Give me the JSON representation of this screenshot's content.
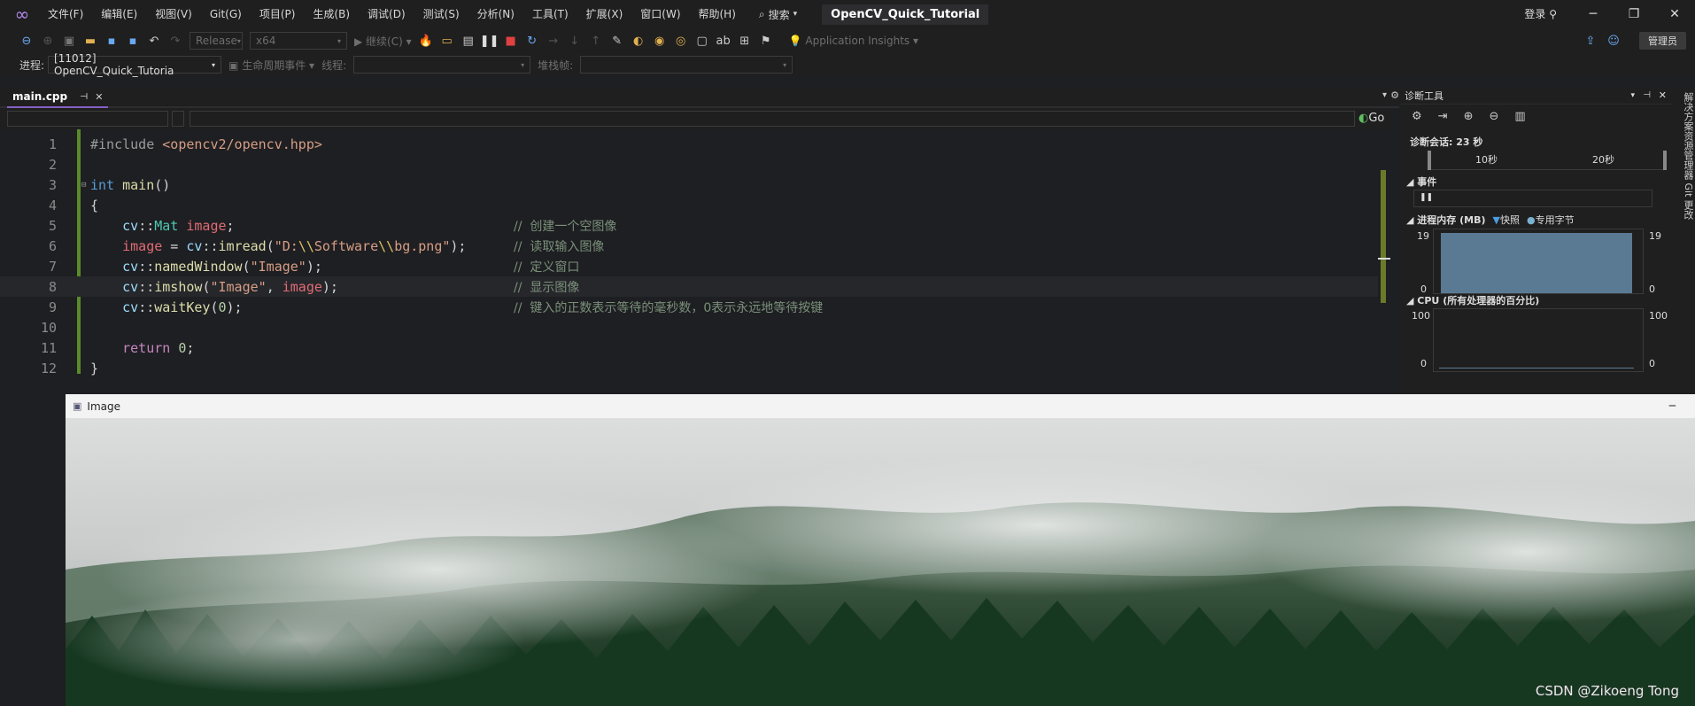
{
  "menu": [
    "文件(F)",
    "编辑(E)",
    "视图(V)",
    "Git(G)",
    "项目(P)",
    "生成(B)",
    "调试(D)",
    "测试(S)",
    "分析(N)",
    "工具(T)",
    "扩展(X)",
    "窗口(W)",
    "帮助(H)"
  ],
  "search_label": "搜索",
  "solution_title": "OpenCV_Quick_Tutorial",
  "login_label": "登录",
  "admin_label": "管理员",
  "toolbar": {
    "config": "Release",
    "platform": "x64",
    "continue_label": "继续(C)",
    "app_insights": "Application Insights"
  },
  "debug_bar": {
    "process_label": "进程:",
    "process_value": "[11012] OpenCV_Quick_Tutoria",
    "lifecycle_label": "生命周期事件",
    "thread_label": "线程:",
    "stackframe_label": "堆栈帧:"
  },
  "tab": {
    "name": "main.cpp"
  },
  "go_label": "Go",
  "code": {
    "lines": [
      "1",
      "2",
      "3",
      "4",
      "5",
      "6",
      "7",
      "8",
      "9",
      "10",
      "11",
      "12"
    ],
    "comments": {
      "l5": "//  创建一个空图像",
      "l6": "//  读取输入图像",
      "l7": "//  定义窗口",
      "l8": "//  显示图像",
      "l9": "//  键入的正数表示等待的毫秒数，0表示永远地等待按键"
    }
  },
  "diagnostics": {
    "title": "诊断工具",
    "session": "诊断会话: 23 秒",
    "ticks": [
      "10秒",
      "20秒"
    ],
    "events_label": "事件",
    "memory_label": "进程内存 (MB)",
    "snapshot_label": "快照",
    "private_label": "专用字节",
    "mem_max": "19",
    "mem_min": "0",
    "mem_max_r": "19",
    "mem_min_r": "0",
    "cpu_label": "CPU (所有处理器的百分比)",
    "cpu_max": "100",
    "cpu_min": "0",
    "cpu_max_r": "100",
    "cpu_min_r": "0",
    "side_tabs": "解决方案资源管理器 Git 更改"
  },
  "image_window": {
    "title": "Image",
    "watermark": "CSDN @Zikoeng Tong"
  },
  "colors": {
    "accent": "#8560c4",
    "changebar": "#5a8a2a"
  }
}
